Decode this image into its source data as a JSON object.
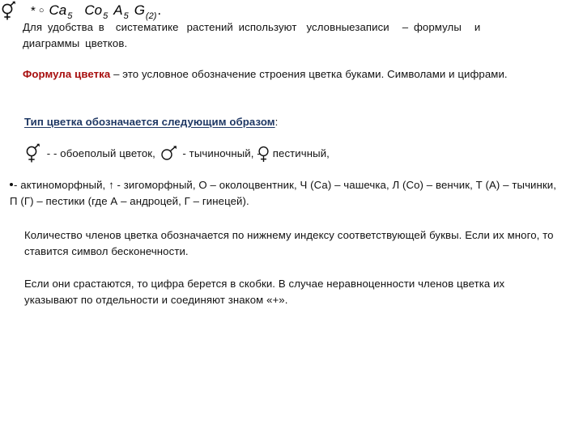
{
  "slide": {
    "background_color": "#ffffff",
    "accent_colors": {
      "term_red": "#A70E0E",
      "term_blue": "#1F3864",
      "body_text": "#111111"
    }
  },
  "intro": {
    "seg1": "Для удобства в",
    "seg2": "систематике",
    "seg3": "растений",
    "seg4": "используют",
    "seg5": "условныезаписи",
    "seg6": "–",
    "seg7": "формулы",
    "seg8": "и",
    "seg9": "диаграммы цветков."
  },
  "formula_def": {
    "term": "Формула цветка",
    "rest": " – это условное обозначение строения цветка буками. Символами и цифрами."
  },
  "type_heading": {
    "text": " Тип цветка обозначается следующим образом",
    "colon": ":"
  },
  "symbols": {
    "hermaphrodite_icon": "hermaphrodite-symbol",
    "male_icon": "mars-symbol",
    "female_icon": "venus-symbol",
    "text_after_hermaphrodite": " -  - обоеполый цветок, ",
    "text_after_male": " - тычиночный, -",
    "text_after_female": "пестичный,"
  },
  "morphology": {
    "bullet_icon": "bullet-dot",
    "line": "- актиноморфный, ↑ - зигоморфный, О – околоцвентник, Ч (Са) – чашечка, Л (Со) – венчик, Т (А) – тычинки, П (Г) – пестики (где А – андроцей, Г – гинецей)."
  },
  "count_rule": {
    "text": "Количество членов цветка обозначается по нижнему индексу соответствующей буквы. Если их много, то ставится символ бесконечности."
  },
  "fusion_rule": {
    "text": "Если они срастаются, то цифра берется в скобки. В случае неравноценности членов цветка их указывают по отдельности и соединяют знаком «+»."
  },
  "flower_formula": {
    "symbol_icon": "hermaphrodite-symbol",
    "star": "*",
    "circle": "○",
    "calyx_letter": "Ca",
    "calyx_sub": "5",
    "corolla_letter": "Co",
    "corolla_sub": "5",
    "androecium_letter": "A",
    "androecium_sub": "5",
    "gynoecium_letter": "G",
    "gynoecium_sub": "(2)",
    "period": "."
  }
}
